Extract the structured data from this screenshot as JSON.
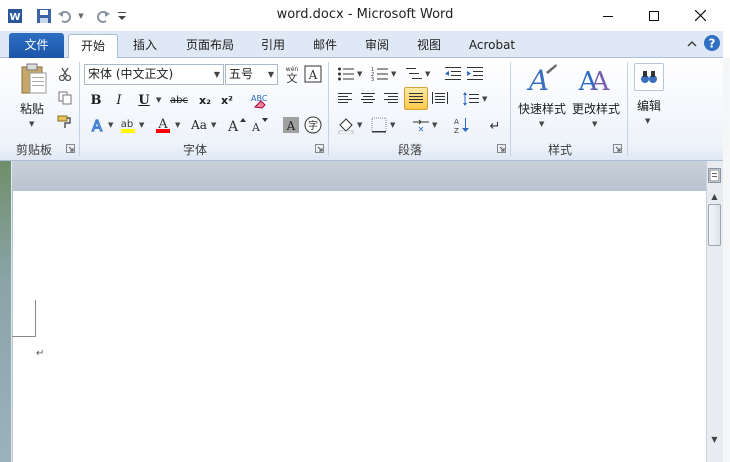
{
  "window": {
    "title": "word.docx - Microsoft Word"
  },
  "tabs": {
    "file": "文件",
    "items": [
      "开始",
      "插入",
      "页面布局",
      "引用",
      "邮件",
      "审阅",
      "视图",
      "Acrobat"
    ]
  },
  "clipboard": {
    "paste_label": "粘贴",
    "group_label": "剪贴板"
  },
  "font": {
    "family": "宋体 (中文正文)",
    "size": "五号",
    "group_label": "字体",
    "bold": "B",
    "italic": "I",
    "underline": "U",
    "strike": "abc",
    "subscript": "x₂",
    "superscript": "x²",
    "change_case": "Aa",
    "grow": "A",
    "shrink": "A",
    "phonetic_guide": "wén",
    "char_border": "A",
    "char_shading": "A",
    "enclose_char": "字"
  },
  "paragraph": {
    "group_label": "段落"
  },
  "styles": {
    "quick_styles": "快速样式",
    "change_styles": "更改样式",
    "group_label": "样式"
  },
  "editing": {
    "label": "编辑"
  },
  "colors": {
    "file_tab": "#2b6ac0",
    "highlight": "#ffff00",
    "font_color": "#ff0000",
    "accent": "#2b579a"
  }
}
